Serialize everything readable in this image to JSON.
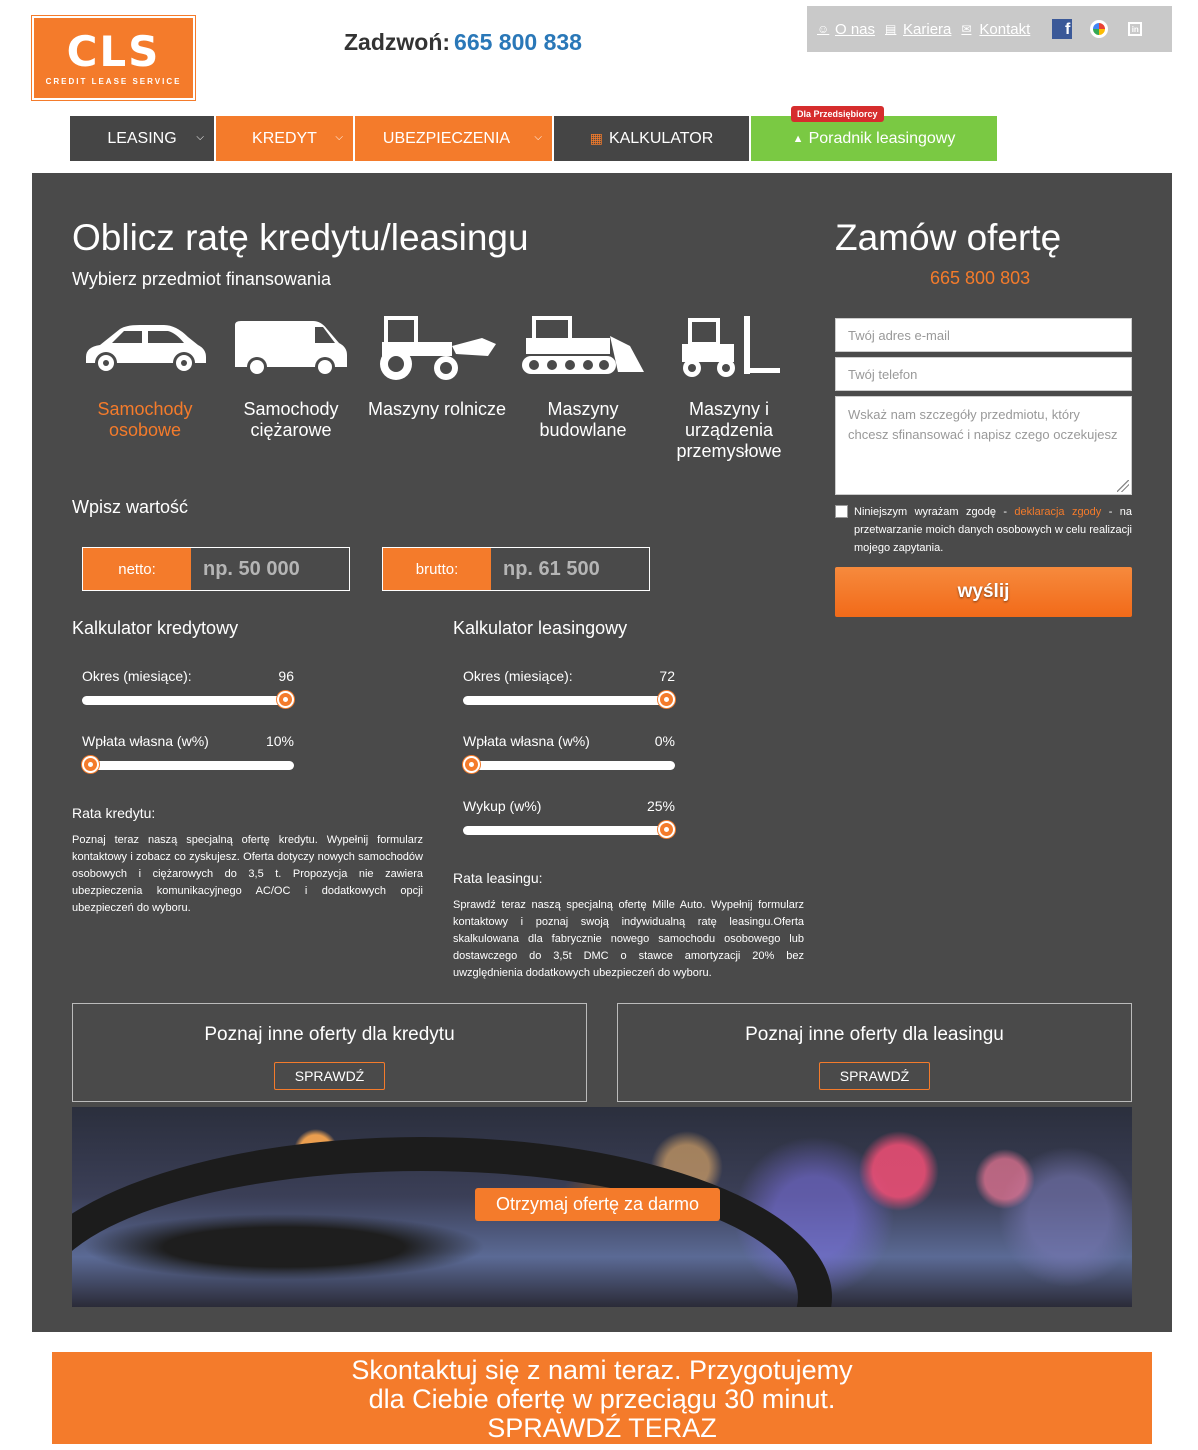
{
  "header": {
    "logo_text": "CLS",
    "logo_sub": "CREDIT  LEASE  SERVICE",
    "call_label": "Zadzwoń:",
    "call_number": "665 800 838",
    "top_links": [
      {
        "label": "O nas",
        "icon": "user-icon"
      },
      {
        "label": "Kariera",
        "icon": "newspaper-icon"
      },
      {
        "label": "Kontakt",
        "icon": "envelope-icon"
      }
    ],
    "social": [
      "facebook-icon",
      "google-icon",
      "linkedin-icon"
    ]
  },
  "nav": {
    "items": [
      {
        "label": "LEASING",
        "style": "dark",
        "dropdown": true
      },
      {
        "label": "KREDYT",
        "style": "orange",
        "dropdown": true
      },
      {
        "label": "UBEZPIECZENIA",
        "style": "orange",
        "dropdown": true
      },
      {
        "label": "KALKULATOR",
        "style": "dark",
        "icon": "calculator-icon"
      },
      {
        "label": "Poradnik leasingowy",
        "style": "green",
        "icon": "graduation-cap-icon",
        "badge": "Dla Przedsiębiorcy"
      }
    ]
  },
  "calculator": {
    "title": "Oblicz ratę kredytu/leasingu",
    "subtitle": "Wybierz przedmiot finansowania",
    "vehicles": [
      {
        "label": "Samochody osobowe",
        "icon": "car-icon",
        "active": true
      },
      {
        "label": "Samochody ciężarowe",
        "icon": "van-icon",
        "active": false
      },
      {
        "label": "Maszyny rolnicze",
        "icon": "tractor-icon",
        "active": false
      },
      {
        "label": "Maszyny budowlane",
        "icon": "bulldozer-icon",
        "active": false
      },
      {
        "label": "Maszyny i urządzenia przemysłowe",
        "icon": "forklift-icon",
        "active": false
      }
    ],
    "value_heading": "Wpisz wartość",
    "netto": {
      "tag": "netto:",
      "placeholder": "np. 50 000"
    },
    "brutto": {
      "tag": "brutto:",
      "placeholder": "np. 61 500"
    },
    "credit": {
      "heading": "Kalkulator kredytowy",
      "sliders": [
        {
          "label": "Okres (miesiące):",
          "value": "96",
          "fraction": 1.0
        },
        {
          "label": "Wpłata własna (w%)",
          "value": "10%",
          "fraction": 0.0
        }
      ],
      "rate_heading": "Rata kredytu:",
      "rate_text": "Poznaj teraz naszą specjalną ofertę kredytu. Wypełnij formularz kontaktowy i zobacz co zyskujesz. Oferta dotyczy nowych samochodów osobowych i ciężarowych do 3,5 t. Propozycja nie zawiera ubezpieczenia komunikacyjnego AC/OC i dodatkowych opcji ubezpieczeń do wyboru."
    },
    "leasing": {
      "heading": "Kalkulator leasingowy",
      "sliders": [
        {
          "label": "Okres (miesiące):",
          "value": "72",
          "fraction": 1.0
        },
        {
          "label": "Wpłata własna (w%)",
          "value": "0%",
          "fraction": 0.0
        },
        {
          "label": "Wykup (w%)",
          "value": "25%",
          "fraction": 1.0
        }
      ],
      "rate_heading": "Rata leasingu:",
      "rate_text": "Sprawdź teraz naszą specjalną ofertę Mille Auto. Wypełnij formularz kontaktowy i poznaj swoją indywidualną ratę leasingu.Oferta skalkulowana dla fabrycznie nowego samochodu osobowego lub dostawczego do 3,5t DMC o stawce amortyzacji 20% bez uwzględnienia dodatkowych ubezpieczeń do wyboru."
    },
    "offer_credit": {
      "title": "Poznaj inne oferty dla kredytu",
      "button": "SPRAWDŹ"
    },
    "offer_leasing": {
      "title": "Poznaj inne oferty dla leasingu",
      "button": "SPRAWDŹ"
    },
    "banner_button": "Otrzymaj ofertę za darmo"
  },
  "order_form": {
    "title": "Zamów ofertę",
    "phone": "665 800 803",
    "email_placeholder": "Twój adres e-mail",
    "phone_placeholder": "Twój telefon",
    "details_placeholder": "Wskaż nam szczegóły przedmiotu, który chcesz sfinansować i napisz czego oczekujesz",
    "consent_pre": "Niniejszym wyrażam zgodę -",
    "consent_link": "deklaracja zgody",
    "consent_post": "- na przetwarzanie moich danych osobowych w celu realizacji mojego zapytania.",
    "submit": "wyślij"
  },
  "cta": {
    "line1": "Skontaktuj się z nami teraz. Przygotujemy",
    "line2": "dla Ciebie ofertę w przeciągu 30 minut.",
    "line3": "SPRAWDŹ TERAZ"
  },
  "colors": {
    "accent": "#f47b2b",
    "panel": "#4a4a4a",
    "green": "#7ac943",
    "phone_blue": "#2a78b8"
  }
}
